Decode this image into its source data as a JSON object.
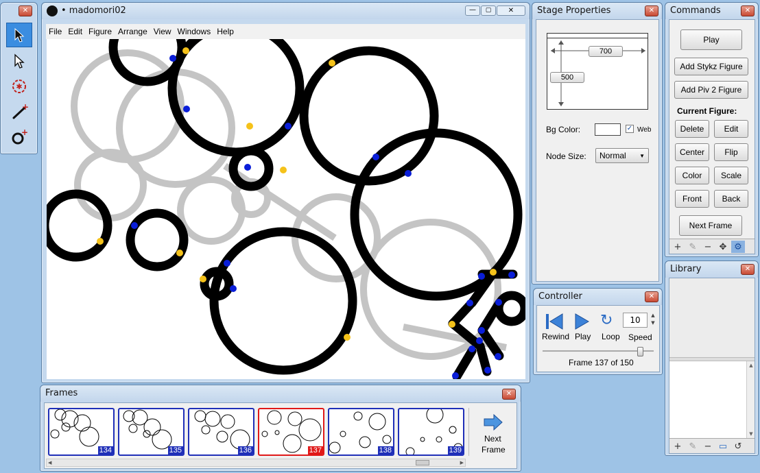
{
  "main_window": {
    "title": "• madomori02",
    "menu": [
      "File",
      "Edit",
      "Figure",
      "Arrange",
      "View",
      "Windows",
      "Help"
    ]
  },
  "tools": {
    "items": [
      "select-arrow",
      "node-select-arrow",
      "circle-joint-tool",
      "add-line-tool",
      "add-circle-tool"
    ]
  },
  "stage_properties": {
    "title": "Stage Properties",
    "width": "700",
    "height": "500",
    "bg_color_label": "Bg Color:",
    "web_label": "Web",
    "web_checked": true,
    "bg_color": "#ffffff",
    "node_size_label": "Node Size:",
    "node_size_value": "Normal"
  },
  "commands": {
    "title": "Commands",
    "play": "Play",
    "add_stykz": "Add Stykz Figure",
    "add_piv2": "Add Piv 2 Figure",
    "current_figure_label": "Current Figure:",
    "delete": "Delete",
    "edit": "Edit",
    "center": "Center",
    "flip": "Flip",
    "color": "Color",
    "scale": "Scale",
    "front": "Front",
    "back": "Back",
    "next_frame": "Next Frame"
  },
  "controller": {
    "title": "Controller",
    "rewind": "Rewind",
    "play": "Play",
    "loop": "Loop",
    "speed_label": "Speed",
    "speed_value": "10",
    "frame_text": "Frame 137 of 150"
  },
  "library": {
    "title": "Library"
  },
  "frames": {
    "title": "Frames",
    "thumbs": [
      "134",
      "135",
      "136",
      "137",
      "138",
      "139"
    ],
    "current": "137",
    "next_line1": "Next",
    "next_line2": "Frame"
  },
  "colors": {
    "accent": "#3b8de0",
    "frame_border": "#1f2fb8",
    "current_frame": "#e01818",
    "node_blue": "#0a1ed8",
    "node_yellow": "#f5c21a",
    "onion_gray": "#c4c4c4"
  }
}
